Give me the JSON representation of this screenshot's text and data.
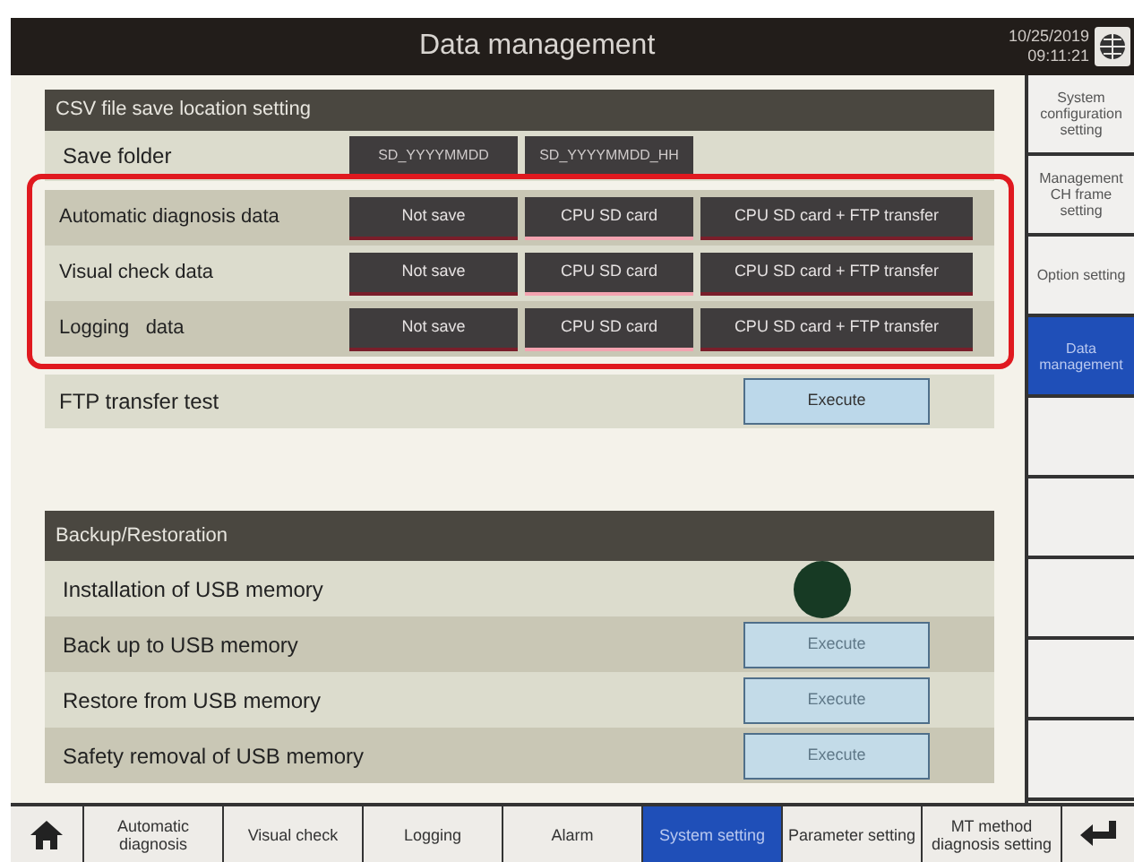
{
  "header": {
    "title": "Data management",
    "date": "10/25/2019",
    "time": "09:11:21"
  },
  "csv_section": {
    "title": "CSV file save location setting",
    "save_folder": {
      "label": "Save folder",
      "options": [
        {
          "label": "SD_YYYYMMDD"
        },
        {
          "label": "SD_YYYYMMDD_HH"
        }
      ]
    },
    "rows": [
      {
        "label": "Automatic diagnosis data",
        "options": [
          {
            "label": "Not save",
            "selected": false
          },
          {
            "label": "CPU SD card",
            "selected": true
          },
          {
            "label": "CPU SD card + FTP transfer",
            "selected": false
          }
        ]
      },
      {
        "label": "Visual check data",
        "options": [
          {
            "label": "Not save",
            "selected": false
          },
          {
            "label": "CPU SD card",
            "selected": true
          },
          {
            "label": "CPU SD card + FTP transfer",
            "selected": false
          }
        ]
      },
      {
        "label": "Logging   data",
        "options": [
          {
            "label": "Not save",
            "selected": false
          },
          {
            "label": "CPU SD card",
            "selected": true
          },
          {
            "label": "CPU SD card + FTP transfer",
            "selected": false
          }
        ]
      }
    ],
    "ftp_test": {
      "label": "FTP transfer test",
      "button": "Execute",
      "disabled": false
    }
  },
  "backup_section": {
    "title": "Backup/Restoration",
    "rows": [
      {
        "kind": "lamp",
        "label": "Installation of USB memory",
        "on": false
      },
      {
        "kind": "button",
        "label": "Back up to USB memory",
        "button": "Execute",
        "disabled": true
      },
      {
        "kind": "button",
        "label": "Restore from USB memory",
        "button": "Execute",
        "disabled": true
      },
      {
        "kind": "button",
        "label": "Safety removal of USB memory",
        "button": "Execute",
        "disabled": true
      }
    ]
  },
  "sidebar": {
    "items": [
      {
        "label": "System configuration setting",
        "selected": false
      },
      {
        "label": "Management CH frame setting",
        "selected": false
      },
      {
        "label": "Option setting",
        "selected": false
      },
      {
        "label": "Data management",
        "selected": true
      },
      {
        "selected": false
      },
      {
        "selected": false
      },
      {
        "selected": false
      },
      {
        "selected": false
      },
      {
        "selected": false
      }
    ]
  },
  "bottom_nav": {
    "items": [
      {
        "label": "Automatic diagnosis",
        "selected": false
      },
      {
        "label": "Visual check",
        "selected": false
      },
      {
        "label": "Logging",
        "selected": false
      },
      {
        "label": "Alarm",
        "selected": false
      },
      {
        "label": "System setting",
        "selected": true
      },
      {
        "label": "Parameter setting",
        "selected": false
      },
      {
        "label": "MT method diagnosis setting",
        "selected": false
      }
    ]
  }
}
